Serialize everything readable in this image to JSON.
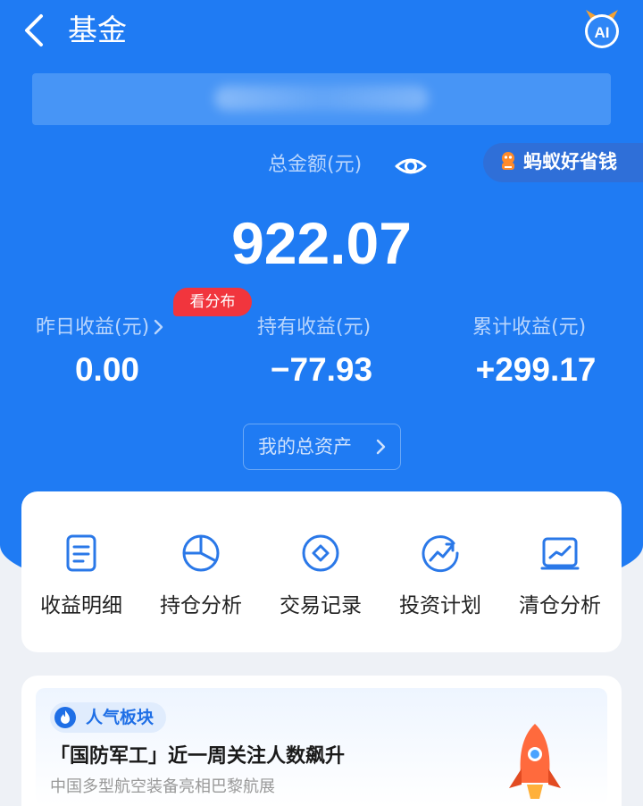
{
  "header": {
    "title": "基金",
    "ai_badge": "AI"
  },
  "summary": {
    "total_label": "总金额(元)",
    "total_value": "922.07",
    "promo_text": "蚂蚁好省钱",
    "dist_badge": "看分布"
  },
  "stats": [
    {
      "label": "昨日收益(元)",
      "value": "0.00"
    },
    {
      "label": "持有收益(元)",
      "value": "−77.93"
    },
    {
      "label": "累计收益(元)",
      "value": "+299.17"
    }
  ],
  "assets_button": "我的总资产",
  "menu": [
    {
      "label": "收益明细",
      "icon": "document-icon"
    },
    {
      "label": "持仓分析",
      "icon": "pie-chart-icon"
    },
    {
      "label": "交易记录",
      "icon": "diamond-circle-icon"
    },
    {
      "label": "投资计划",
      "icon": "trend-circle-icon"
    },
    {
      "label": "清仓分析",
      "icon": "chart-board-icon"
    }
  ],
  "news": {
    "tag": "人气板块",
    "title": "「国防军工」近一周关注人数飙升",
    "subtitle": "中国多型航空装备亮相巴黎航展"
  },
  "colors": {
    "primary_blue": "#1f7bf3",
    "badge_red": "#f1353d",
    "icon_blue": "#2a78e8"
  }
}
